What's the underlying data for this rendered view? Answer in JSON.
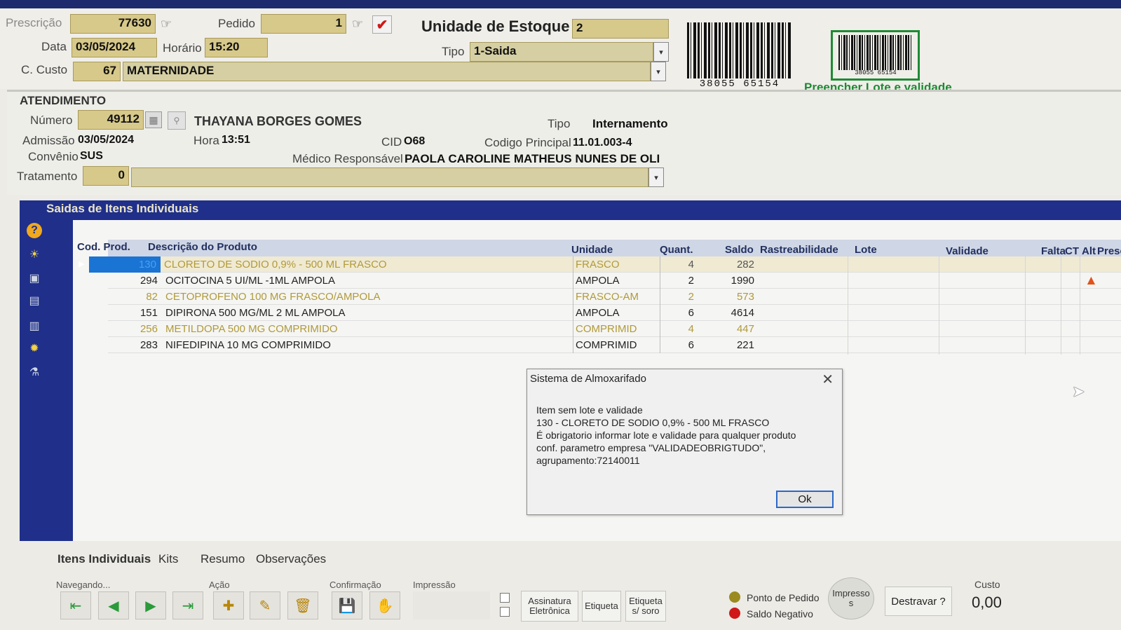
{
  "header": {
    "prescricao_label": "Prescrição",
    "prescricao_value": "77630",
    "pedido_label": "Pedido",
    "pedido_value": "1",
    "unidade_label": "Unidade de Estoque",
    "unidade_value": "2",
    "data_label": "Data",
    "data_value": "03/05/2024",
    "horario_label": "Horário",
    "horario_value": "15:20",
    "tipo_label": "Tipo",
    "tipo_value": "1-Saida",
    "ccusto_label": "C. Custo",
    "ccusto_code": "67",
    "ccusto_name": "MATERNIDADE",
    "barcode_number": "38055 65154",
    "barcode_small_number": "38055 65154",
    "preencher_label": "Preencher Lote e validade"
  },
  "atendimento": {
    "section_title": "ATENDIMENTO",
    "numero_label": "Número",
    "numero_value": "49112",
    "patient_name": "THAYANA BORGES GOMES",
    "tipo_label": "Tipo",
    "tipo_value": "Internamento",
    "admissao_label": "Admissão",
    "admissao_value": "03/05/2024",
    "hora_label": "Hora",
    "hora_value": "13:51",
    "cid_label": "CID",
    "cid_value": "O68",
    "codigo_label": "Codigo Principal",
    "codigo_value": "11.01.003-4",
    "convenio_label": "Convênio",
    "convenio_value": "SUS",
    "medico_label": "Médico Responsável",
    "medico_value": "PAOLA CAROLINE MATHEUS NUNES DE OLI",
    "tratamento_label": "Tratamento",
    "tratamento_value": "0"
  },
  "panel": {
    "title": "Saidas de Itens Individuais",
    "columns": [
      "Cod. Prod.",
      "Descrição do Produto",
      "Unidade",
      "Quant.",
      "Saldo",
      "Rastreabilidade",
      "Lote",
      "Validade",
      "Falta",
      "CT",
      "Alt",
      "Prescrit"
    ],
    "rows": [
      {
        "cod": "130",
        "desc": "CLORETO DE SODIO 0,9% - 500 ML FRASCO",
        "unidade": "FRASCO",
        "quant": "4",
        "saldo": "282"
      },
      {
        "cod": "294",
        "desc": "OCITOCINA 5 UI/ML -1ML AMPOLA",
        "unidade": "AMPOLA",
        "quant": "2",
        "saldo": "1990"
      },
      {
        "cod": "82",
        "desc": "CETOPROFENO 100 MG FRASCO/AMPOLA",
        "unidade": "FRASCO-AM",
        "quant": "2",
        "saldo": "573"
      },
      {
        "cod": "151",
        "desc": "DIPIRONA 500 MG/ML 2 ML  AMPOLA",
        "unidade": "AMPOLA",
        "quant": "6",
        "saldo": "4614"
      },
      {
        "cod": "256",
        "desc": "METILDOPA 500 MG COMPRIMIDO",
        "unidade": "COMPRIMID",
        "quant": "4",
        "saldo": "447"
      },
      {
        "cod": "283",
        "desc": "NIFEDIPINA 10 MG COMPRIMIDO",
        "unidade": "COMPRIMID",
        "quant": "6",
        "saldo": "221"
      }
    ]
  },
  "dialog": {
    "title": "Sistema de Almoxarifado",
    "lines": [
      "Item sem lote e validade",
      "130 - CLORETO DE SODIO 0,9% - 500 ML FRASCO",
      "É obrigatorio informar lote e validade para qualquer produto",
      "conf. parametro empresa \"VALIDADEOBRIGTUDO\",",
      "agrupamento:72140011"
    ],
    "ok_label": "Ok"
  },
  "bottom": {
    "tabs": [
      "Itens Individuais",
      "Kits",
      "Resumo",
      "Observações"
    ],
    "group_navegando": "Navegando...",
    "group_acao": "Ação",
    "group_confirmacao": "Confirmação",
    "group_impressao": "Impressão",
    "btn_assinatura": "Assinatura Eletrônica",
    "btn_etiqueta": "Etiqueta",
    "btn_etiqueta_soro": "Etiqueta s/ soro",
    "legend_ponto": "Ponto de Pedido",
    "legend_saldo": "Saldo Negativo",
    "btn_impressos": "Impresso s",
    "btn_destravar": "Destravar ?",
    "custo_label": "Custo",
    "custo_value": "0,00"
  },
  "colors": {
    "field_bg": "#d7c98a",
    "panel_blue": "#1f2f8a",
    "gold_text": "#b09a3a",
    "green_accent": "#1e8a34",
    "legend_gold": "#9b8a1f",
    "legend_red": "#d01818"
  }
}
